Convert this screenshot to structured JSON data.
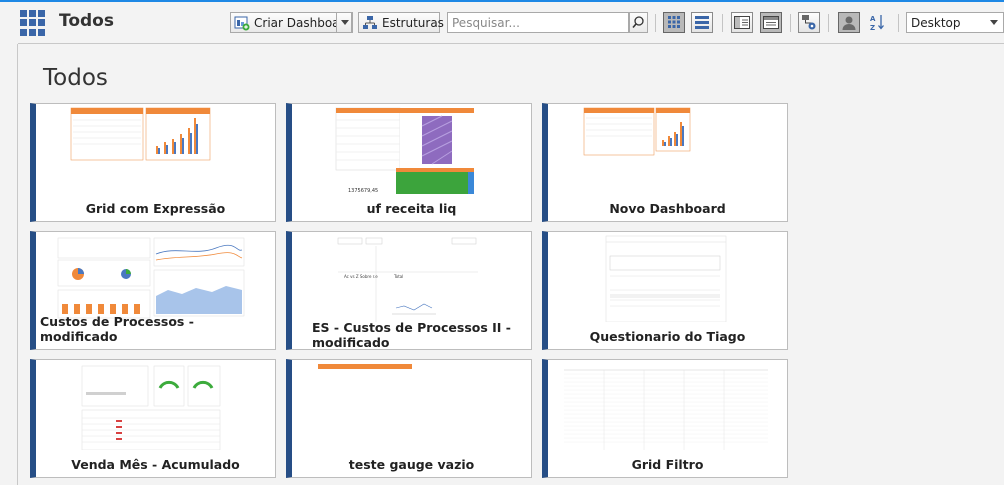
{
  "header": {
    "title": "Todos",
    "create_dashboard_label": "Criar Dashboard",
    "structures_label": "Estruturas",
    "search_placeholder": "Pesquisar...",
    "device_select": "Desktop"
  },
  "page": {
    "title": "Todos"
  },
  "cards": [
    {
      "title": "Grid com Expressão"
    },
    {
      "title": "uf receita liq"
    },
    {
      "title": "Novo Dashboard"
    },
    {
      "title": "Custos de Processos - modificado"
    },
    {
      "title": "ES - Custos de Processos II - modificado"
    },
    {
      "title": "Questionario do Tiago"
    },
    {
      "title": "Venda Mês - Acumulado"
    },
    {
      "title": "teste gauge vazio"
    },
    {
      "title": "Grid Filtro"
    }
  ],
  "colors": {
    "accent": "#264e86",
    "orange": "#f0893a",
    "topline": "#1e88e5"
  }
}
